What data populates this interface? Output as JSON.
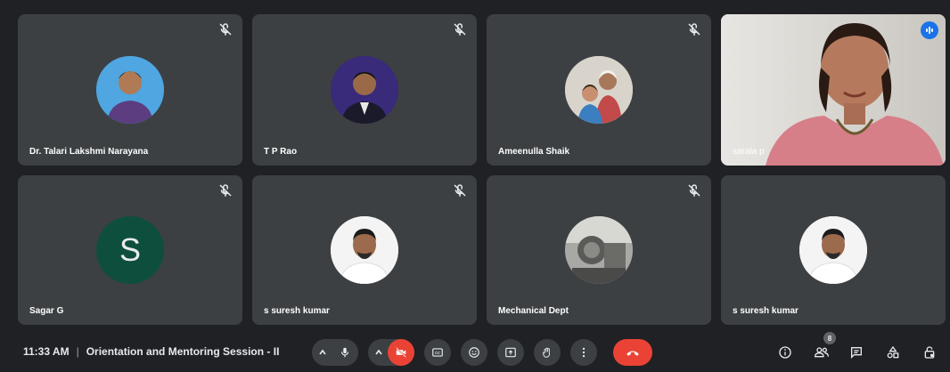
{
  "participants": [
    {
      "name": "Dr. Talari Lakshmi Narayana",
      "muted": true
    },
    {
      "name": "T P Rao",
      "muted": true
    },
    {
      "name": "Ameenulla Shaik",
      "muted": true
    },
    {
      "name": "sarala p",
      "muted": false,
      "speaking": true
    },
    {
      "name": "Sagar G",
      "muted": true,
      "initial": "S"
    },
    {
      "name": "s suresh kumar",
      "muted": true
    },
    {
      "name": "Mechanical Dept",
      "muted": true
    },
    {
      "name": "s suresh kumar",
      "muted": false
    }
  ],
  "bottom_bar": {
    "time": "11:33 AM",
    "separator": "|",
    "meeting_title": "Orientation and Mentoring Session - II",
    "participants_count": "8"
  },
  "colors": {
    "background": "#202124",
    "tile": "#3c4043",
    "end_call": "#ea4335",
    "active_speaker": "#8ab4f8",
    "avatar_letter_bg": "#0d4f3c"
  },
  "icons": [
    "mic-off-icon",
    "audio-level-icon",
    "chevron-up-icon",
    "mic-icon",
    "camera-off-icon",
    "captions-icon",
    "emoji-icon",
    "present-icon",
    "raise-hand-icon",
    "more-options-icon",
    "end-call-icon",
    "info-icon",
    "people-icon",
    "chat-icon",
    "activities-icon",
    "host-controls-icon"
  ]
}
